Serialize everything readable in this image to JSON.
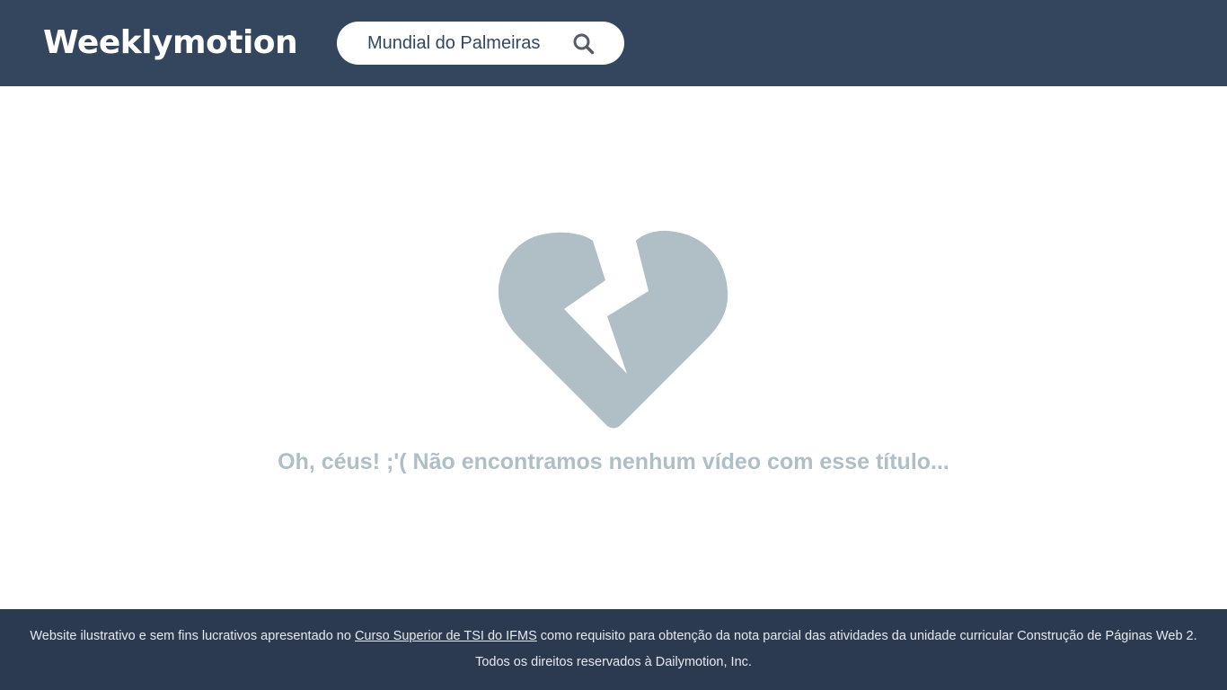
{
  "header": {
    "logo": "Weeklymotion",
    "search": {
      "value": "Mundial do Palmeiras",
      "placeholder": "",
      "icon": "search-icon"
    }
  },
  "main": {
    "icon": "broken-heart-icon",
    "message": "Oh, céus! ;'( Não encontramos nenhum vídeo com esse título..."
  },
  "footer": {
    "line1_before": "Website ilustrativo e sem fins lucrativos apresentado no ",
    "link_text": "Curso Superior de TSI do IFMS",
    "line1_after": " como requisito para obtenção da nota parcial das atividades da unidade curricular Construção de Páginas Web 2.",
    "line2": "Todos os direitos reservados à Dailymotion, Inc."
  },
  "colors": {
    "header_bg": "#34465d",
    "footer_bg": "#2c3a4f",
    "muted": "#b0bec5",
    "white": "#ffffff"
  }
}
